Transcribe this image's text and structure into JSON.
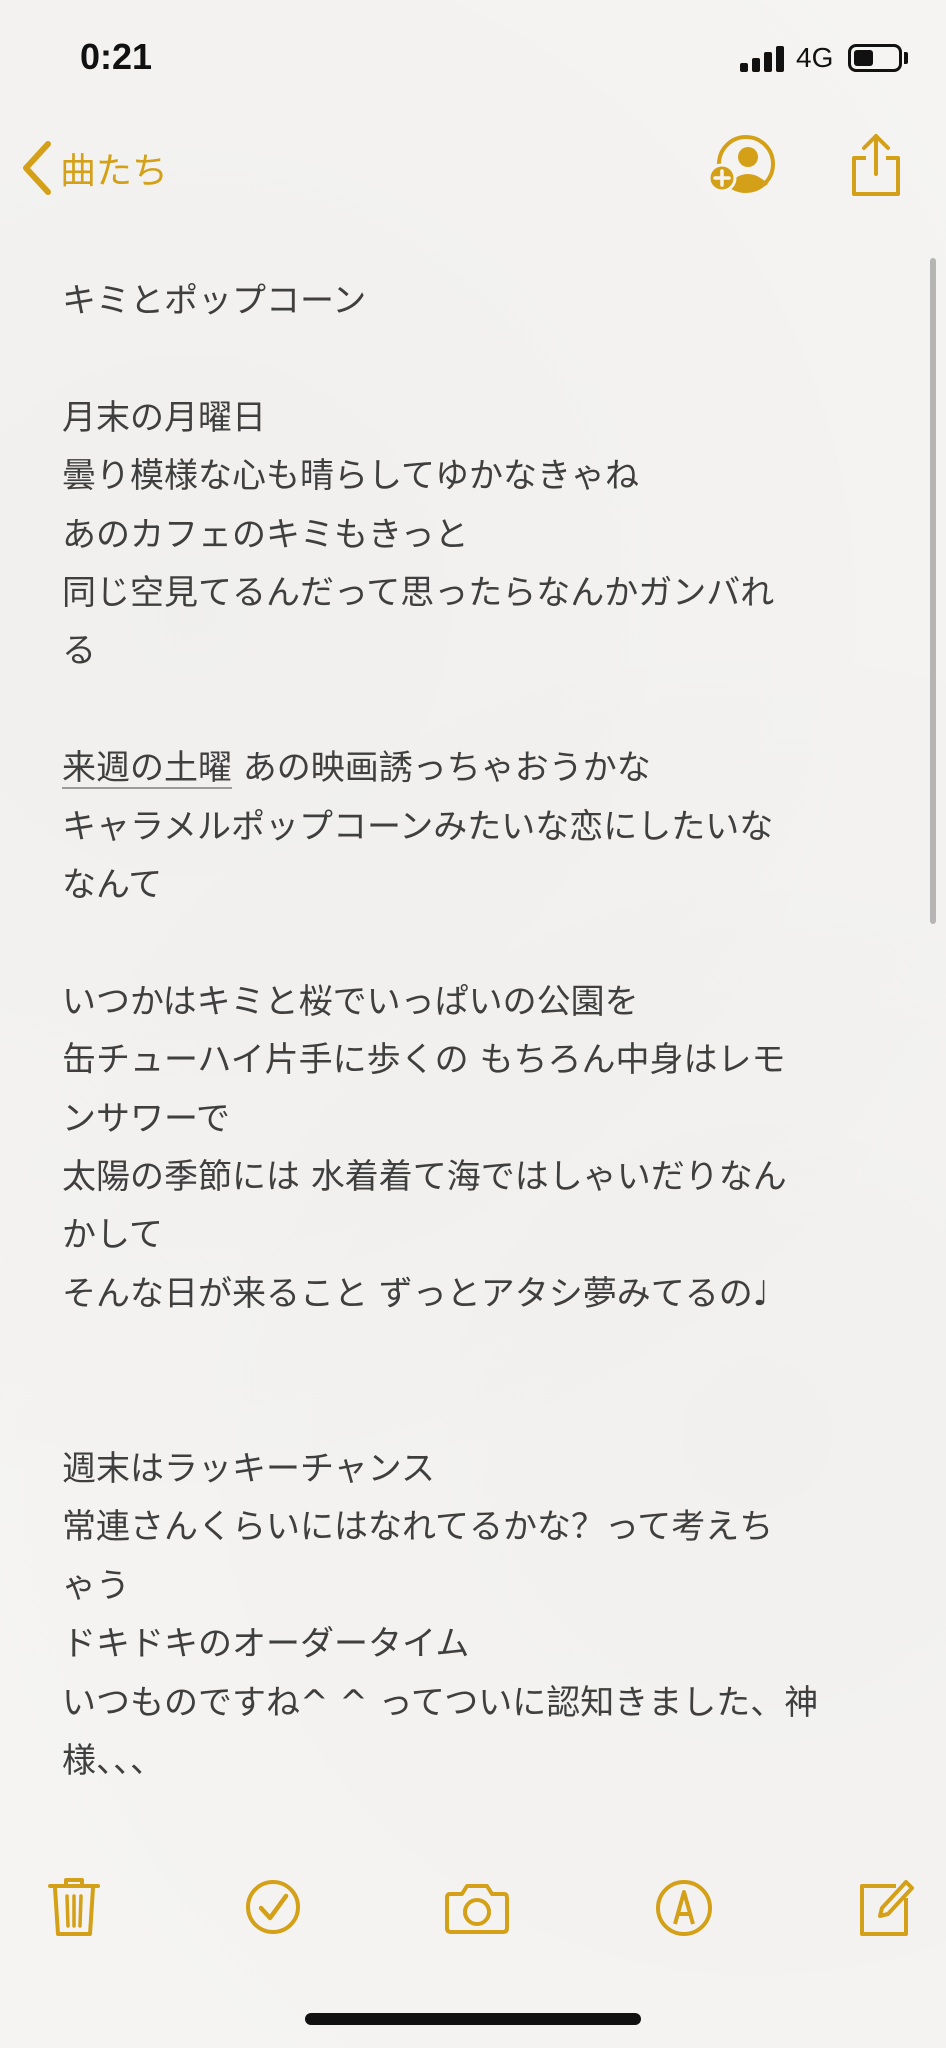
{
  "status_bar": {
    "time": "0:21",
    "network": "4G",
    "battery_level": 0.45
  },
  "nav": {
    "back_label": "曲たち",
    "accent_color": "#d4a017"
  },
  "note": {
    "title": "キミとポップコーン",
    "lines": [
      "",
      "月末の月曜日",
      "曇り模様な心も晴らしてゆかなきゃね",
      "あのカフェのキミもきっと",
      "同じ空見てるんだって思ったらなんかガンバれ",
      "る",
      "",
      "__UNDERLINED__",
      "キャラメルポップコーンみたいな恋にしたいな",
      "なんて",
      "",
      "いつかはキミと桜でいっぱいの公園を",
      "缶チューハイ片手に歩くの もちろん中身はレモ",
      "ンサワーで",
      "太陽の季節には 水着着て海ではしゃいだりなん",
      "かして",
      "そんな日が来ること ずっとアタシ夢みてるの♩",
      "",
      "",
      "週末はラッキーチャンス",
      "常連さんくらいにはなれてるかな？って考えち",
      "ゃう",
      "ドキドキのオーダータイム",
      "いつものですね^ ^ ってついに認知きました、神",
      "様、、、"
    ],
    "underlined_line": {
      "underlined_part": "来週の土曜",
      "rest": " あの映画誘っちゃおうかな"
    }
  },
  "toolbar": {
    "icons": [
      "trash-icon",
      "checklist-icon",
      "camera-icon",
      "markup-icon",
      "compose-icon"
    ]
  }
}
